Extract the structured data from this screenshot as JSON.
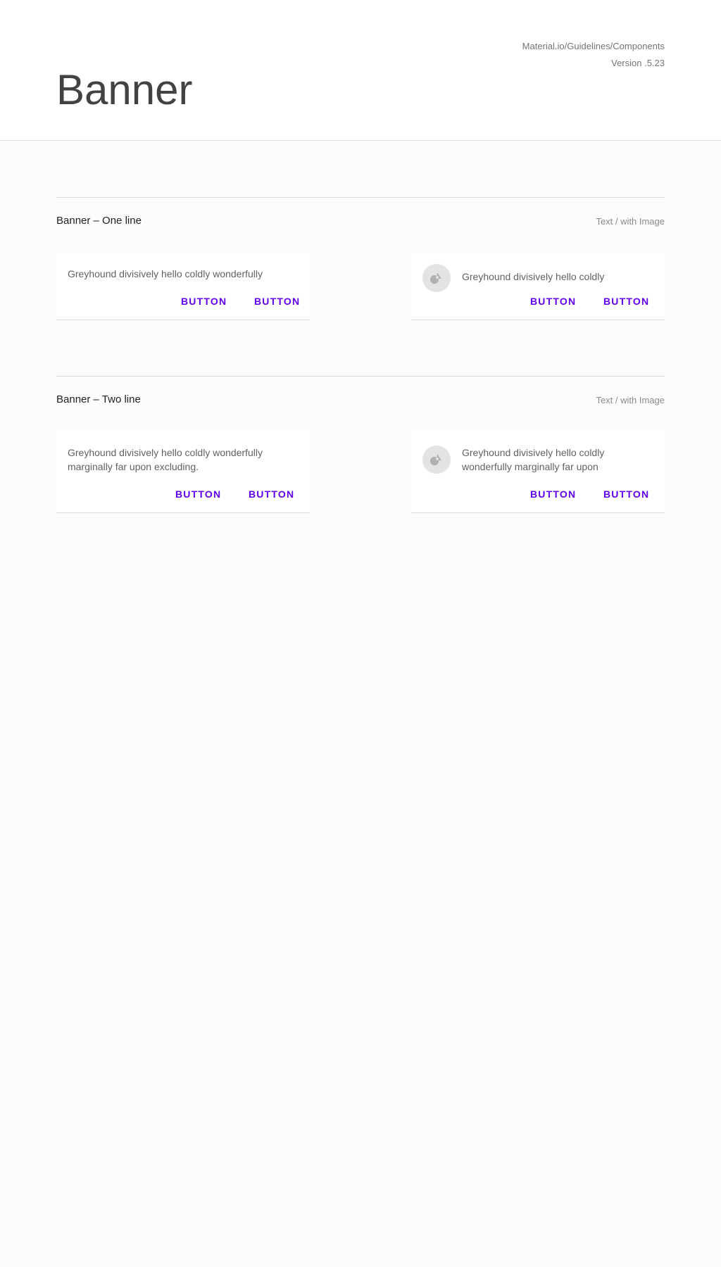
{
  "header": {
    "title": "Banner",
    "meta_line1": "Material.io/Guidelines/Components",
    "meta_line2": "Version .5.23"
  },
  "sections": [
    {
      "title": "Banner – One line",
      "note": "Text / with Image",
      "cards": [
        {
          "text": "Greyhound divisively hello coldly wonderfully",
          "button1": "BUTTON",
          "button2": "BUTTON"
        },
        {
          "icon": "image-icon",
          "text": "Greyhound divisively hello coldly",
          "button1": "BUTTON",
          "button2": "BUTTON"
        }
      ]
    },
    {
      "title": "Banner – Two line",
      "note": "Text / with Image",
      "cards": [
        {
          "text_line1": "Greyhound divisively hello coldly wonderfully",
          "text_line2": "marginally far upon excluding.",
          "button1": "BUTTON",
          "button2": "BUTTON"
        },
        {
          "icon": "image-icon",
          "text_line1": "Greyhound divisively hello coldly",
          "text_line2": "wonderfully marginally far upon",
          "button1": "BUTTON",
          "button2": "BUTTON"
        }
      ]
    }
  ],
  "colors": {
    "accent": "#6200ee",
    "text": "#616161",
    "title": "#424242",
    "divider": "#dcdcdc",
    "avatar_bg": "#e3e3e3"
  }
}
